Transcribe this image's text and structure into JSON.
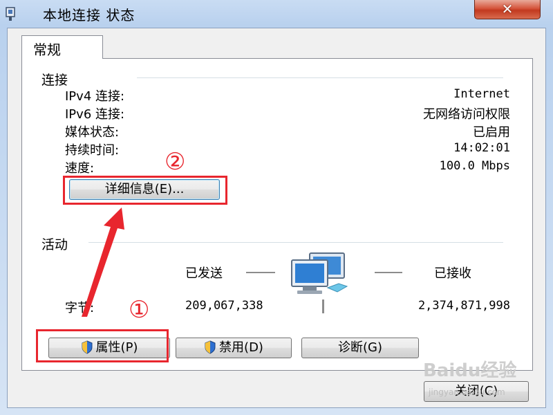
{
  "window": {
    "title": "本地连接 状态",
    "close_symbol": "✕"
  },
  "tabs": [
    {
      "label": "常规",
      "selected": true
    }
  ],
  "connection": {
    "section_title": "连接",
    "rows": [
      {
        "label": "IPv4 连接:",
        "value": "Internet"
      },
      {
        "label": "IPv6 连接:",
        "value": "无网络访问权限"
      },
      {
        "label": "媒体状态:",
        "value": "已启用"
      },
      {
        "label": "持续时间:",
        "value": "14:02:01"
      },
      {
        "label": "速度:",
        "value": "100.0 Mbps"
      }
    ],
    "details_button": "详细信息(E)..."
  },
  "activity": {
    "section_title": "活动",
    "sent_label": "已发送",
    "received_label": "已接收",
    "bytes_label": "字节:",
    "bytes_sent": "209,067,338",
    "bytes_received": "2,374,871,998"
  },
  "buttons": {
    "properties": "属性(P)",
    "disable": "禁用(D)",
    "diagnose": "诊断(G)",
    "close": "关闭(C)"
  },
  "annotations": {
    "step1": "①",
    "step2": "②",
    "color": "#e8262e"
  },
  "watermark": {
    "text": "Baidu经验",
    "sub": "jingyan.baidu.com"
  },
  "colors": {
    "frame": "#c9dcf3",
    "close_button": "#d5543c",
    "highlight": "#e8262e"
  }
}
